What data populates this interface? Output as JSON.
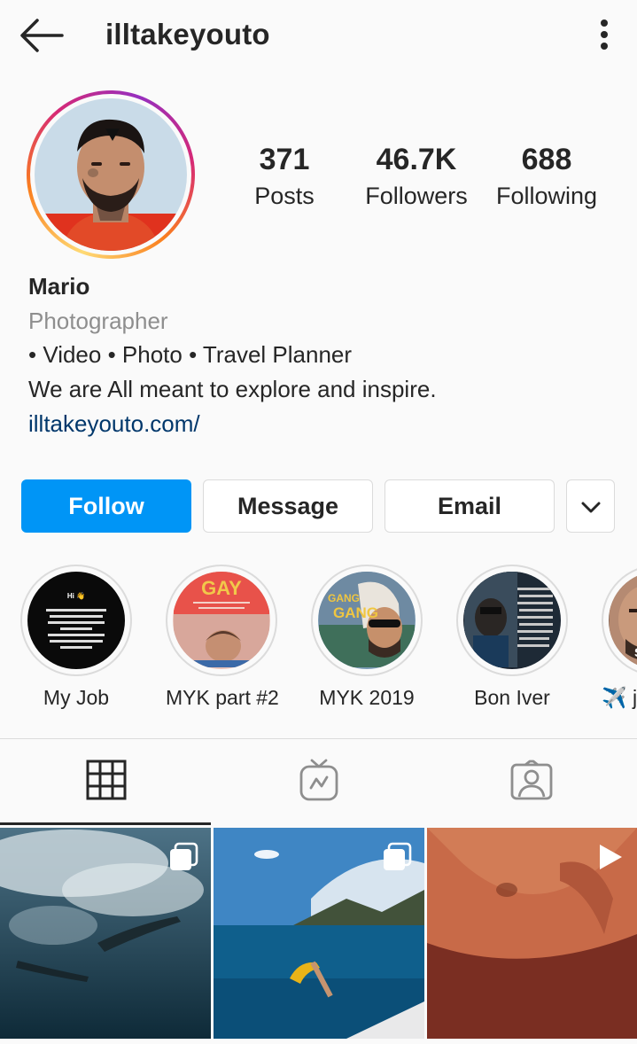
{
  "header": {
    "username": "illtakeyouto"
  },
  "stats": [
    {
      "value": "371",
      "label": "Posts"
    },
    {
      "value": "46.7K",
      "label": "Followers"
    },
    {
      "value": "688",
      "label": "Following"
    }
  ],
  "bio": {
    "name": "Mario",
    "category": "Photographer",
    "line1": "• Video • Photo • Travel Planner",
    "line2": "We are All meant to explore and inspire.",
    "link": "illtakeyouto.com/"
  },
  "actions": {
    "follow": "Follow",
    "message": "Message",
    "email": "Email"
  },
  "highlights": [
    {
      "label": "My Job",
      "cover_text": "Hi 👋\nI decided to clarify to those who seem to not get what exactly I do for living.\nIncluding some close people who have known me for years."
    },
    {
      "label": "MYK part #2",
      "cover_text": "GAY"
    },
    {
      "label": "MYK 2019",
      "cover_text": "GANG GANG"
    },
    {
      "label": "Bon Iver",
      "cover_text": ""
    },
    {
      "label": "✈️ j",
      "cover_text": ""
    }
  ],
  "tabs": [
    "grid-tab",
    "igtv-tab",
    "tagged-tab"
  ],
  "posts": [
    {
      "type": "carousel"
    },
    {
      "type": "carousel"
    },
    {
      "type": "video"
    }
  ],
  "colors": {
    "accent": "#0095f6",
    "link": "#00376b",
    "secondary_text": "#8e8e8e",
    "border": "#dbdbdb"
  }
}
